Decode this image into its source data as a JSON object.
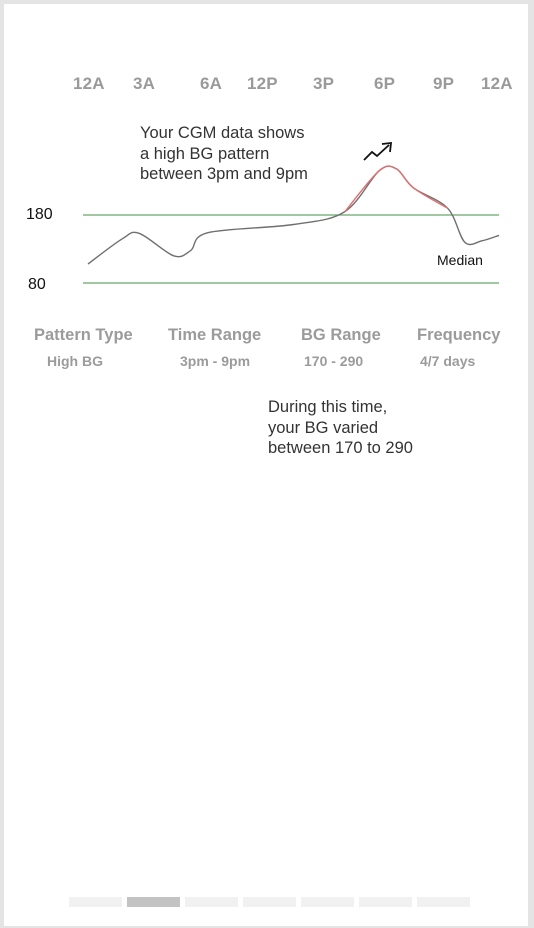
{
  "header": {
    "hours": [
      "12A",
      "3A",
      "6A",
      "12P",
      "3P",
      "6P",
      "9P",
      "12A"
    ]
  },
  "chart_data": {
    "type": "line",
    "x_ticks": [
      "12A",
      "3A",
      "6A",
      "12P",
      "3P",
      "6P",
      "9P",
      "12A"
    ],
    "y_ticks": [
      180,
      80
    ],
    "reference_lines": [
      {
        "value": 180,
        "color": "#6aa76a"
      },
      {
        "value": 80,
        "color": "#6aa76a"
      }
    ],
    "series": [
      {
        "name": "Median",
        "color": "#6f6f6f",
        "highlight_color": "#e07070",
        "highlight_range": [
          "3pm",
          "9pm"
        ],
        "points": [
          [
            "12A",
            108
          ],
          [
            "2A",
            145
          ],
          [
            "3A",
            153
          ],
          [
            "5A",
            120
          ],
          [
            "6A",
            128
          ],
          [
            "7A",
            154
          ],
          [
            "12P",
            166
          ],
          [
            "3P",
            185
          ],
          [
            "5P",
            245
          ],
          [
            "6P",
            248
          ],
          [
            "7P",
            220
          ],
          [
            "9P",
            190
          ],
          [
            "10P",
            140
          ],
          [
            "11P",
            142
          ],
          [
            "12A",
            150
          ]
        ]
      }
    ]
  },
  "callout": {
    "lines": [
      "Your CGM data shows",
      "a high BG pattern",
      "between 3pm and 9pm"
    ],
    "trend_icon": "trending-up-icon"
  },
  "y_labels": {
    "high": "180",
    "low": "80"
  },
  "legend": {
    "median_label": "Median"
  },
  "pattern": {
    "columns": [
      {
        "header": "Pattern Type",
        "value": "High BG"
      },
      {
        "header": "Time Range",
        "value": "3pm - 9pm"
      },
      {
        "header": "BG Range",
        "value": "170 - 290"
      },
      {
        "header": "Frequency",
        "value": "4/7 days"
      }
    ]
  },
  "detail": {
    "lines": [
      "During this time,",
      "your BG varied",
      "between 170  to 290"
    ]
  },
  "pager": {
    "count": 7,
    "active": 1
  }
}
